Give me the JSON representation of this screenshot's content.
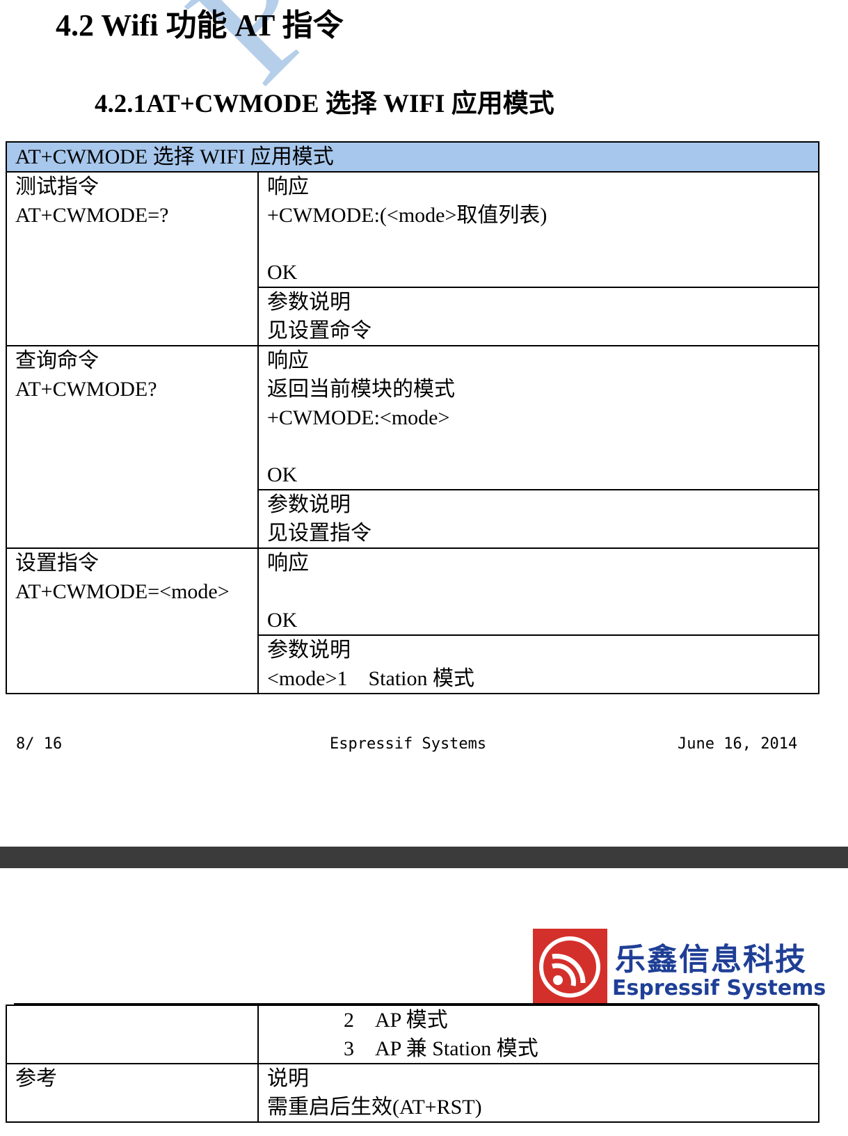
{
  "watermark": "PUBLIC",
  "heading": "4.2 Wifi 功能 AT 指令",
  "subheading": "4.2.1AT+CWMODE 选择 WIFI 应用模式",
  "table1": {
    "header": "AT+CWMODE 选择 WIFI 应用模式",
    "test": {
      "label": "测试指令",
      "cmd": "AT+CWMODE=?",
      "resp_title": "响应",
      "resp_line": "+CWMODE:(<mode>取值列表)",
      "ok": "OK",
      "param_title": "参数说明",
      "param_text": "见设置命令"
    },
    "query": {
      "label": "查询命令",
      "cmd": "AT+CWMODE?",
      "resp_title": "响应",
      "resp_desc": "返回当前模块的模式",
      "resp_line": "+CWMODE:<mode>",
      "ok": "OK",
      "param_title": "参数说明",
      "param_text": "见设置指令"
    },
    "set": {
      "label": "设置指令",
      "cmd": "AT+CWMODE=<mode>",
      "resp_title": "响应",
      "ok": "OK",
      "param_title": "参数说明",
      "mode_prefix": "<mode>1",
      "mode1": "Station 模式"
    }
  },
  "footer": {
    "page": "8/ 16",
    "company": "Espressif Systems",
    "date": "June 16, 2014"
  },
  "logo": {
    "cn": "乐鑫信息科技",
    "en": "Espressif Systems",
    "color": "#1f3f96",
    "mark_color": "#d4302b"
  },
  "table2": {
    "mode2_num": "2",
    "mode2": "AP 模式",
    "mode3_num": "3",
    "mode3": "AP 兼 Station 模式",
    "ref_label": "参考",
    "ref_title": "说明",
    "ref_text": "需重启后生效(AT+RST)"
  }
}
